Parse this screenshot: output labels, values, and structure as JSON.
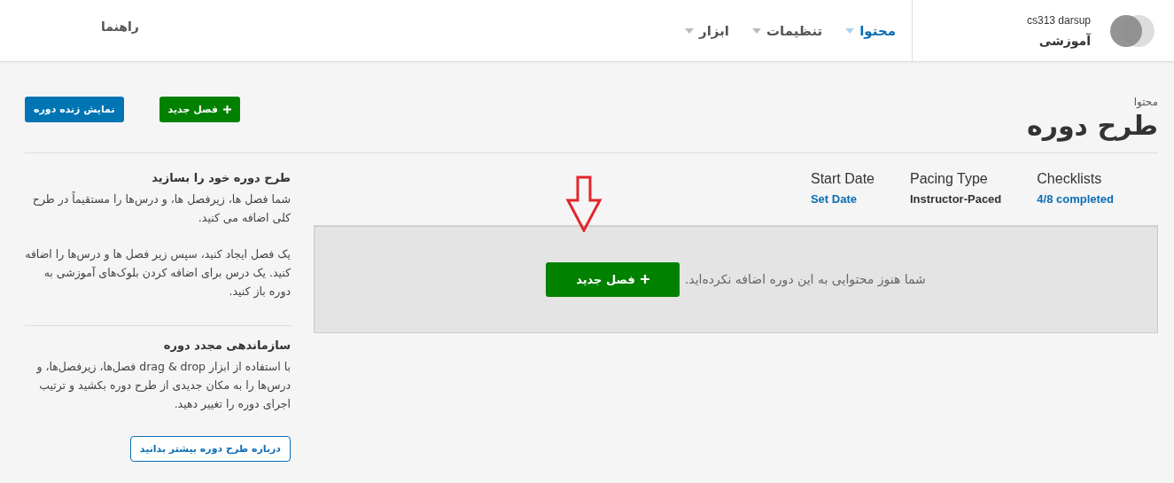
{
  "header": {
    "course_org": "cs313 darsup",
    "course_name": "آموزشی",
    "nav": [
      {
        "label": "محتوا",
        "selected": true
      },
      {
        "label": "تنظیمات",
        "selected": false
      },
      {
        "label": "ابزار",
        "selected": false
      }
    ],
    "help": "راهنما"
  },
  "page": {
    "breadcrumb": "محتوا",
    "title": "طرح دوره",
    "buttons": [
      {
        "label": "فصل جدید",
        "kind": "add"
      },
      {
        "label": "نمایش زنده دوره",
        "kind": "view"
      }
    ]
  },
  "meta": [
    {
      "label": "Checklists",
      "value": "4/8 completed",
      "kind": "link"
    },
    {
      "label": "Pacing Type",
      "value": "Instructor-Paced",
      "kind": "text"
    },
    {
      "label": "Start Date",
      "value": "Set Date",
      "kind": "link"
    }
  ],
  "outline": {
    "empty_message": "شما هنوز محتوایی به این دوره اضافه نکرده‌اید.",
    "button": "فصل جدید"
  },
  "sidebar": {
    "sections": [
      {
        "title": "طرح دوره خود را بسازید",
        "paragraphs": [
          "شما فصل ها، زیرفصل ها، و درس‌ها را مستقیماً در طرح کلی اضافه می کنید.",
          "یک فصل ایجاد کنید، سپس زیر فصل ها و درس‌ها را اضافه کنید. یک درس برای اضافه کردن بلوک‌های آموزشی به دوره باز کنید."
        ]
      },
      {
        "title": "سازماندهی مجدد دوره",
        "paragraphs": [
          "با استفاده از ابزار drag & drop فصل‌ها، زیرفصل‌ها، و درس‌ها را به مکان جدیدی از طرح دوره بکشید و ترتیب اجرای دوره را تغییر دهید."
        ]
      }
    ],
    "link_button": "درباره طرح دوره بیشتر بدانید"
  }
}
